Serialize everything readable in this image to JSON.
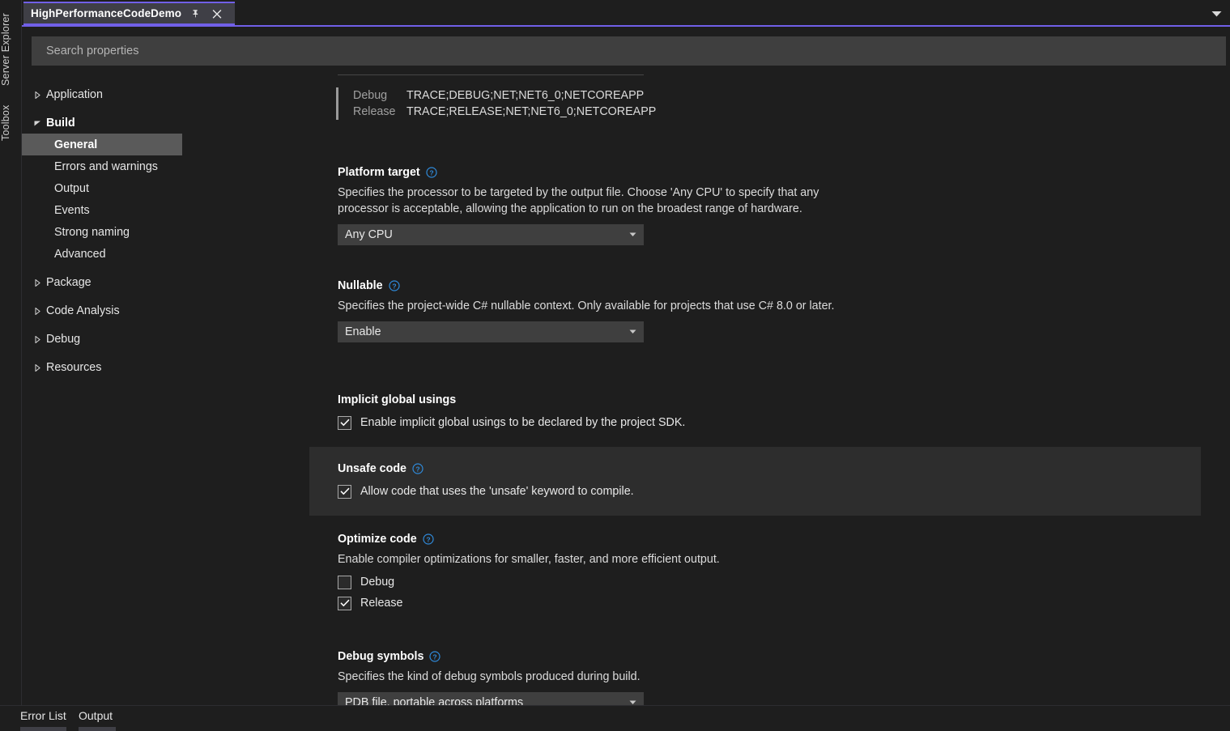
{
  "dock": {
    "server_explorer": "Server Explorer",
    "toolbox": "Toolbox"
  },
  "tab": {
    "title": "HighPerformanceCodeDemo",
    "pin_icon": "pin-icon",
    "close_icon": "close-icon",
    "overflow_icon": "chevron-down-icon",
    "accent_color": "#7160e8"
  },
  "search": {
    "value": "",
    "placeholder": "Search properties"
  },
  "nav": {
    "items": [
      {
        "label": "Application",
        "level": 1,
        "expanded": false,
        "selected": false
      },
      {
        "label": "Build",
        "level": 1,
        "expanded": true,
        "selected": false
      },
      {
        "label": "General",
        "level": 2,
        "selected": true
      },
      {
        "label": "Errors and warnings",
        "level": 2,
        "selected": false
      },
      {
        "label": "Output",
        "level": 2,
        "selected": false
      },
      {
        "label": "Events",
        "level": 2,
        "selected": false
      },
      {
        "label": "Strong naming",
        "level": 2,
        "selected": false
      },
      {
        "label": "Advanced",
        "level": 2,
        "selected": false
      },
      {
        "label": "Package",
        "level": 1,
        "expanded": false,
        "selected": false
      },
      {
        "label": "Code Analysis",
        "level": 1,
        "expanded": false,
        "selected": false
      },
      {
        "label": "Debug",
        "level": 1,
        "expanded": false,
        "selected": false
      },
      {
        "label": "Resources",
        "level": 1,
        "expanded": false,
        "selected": false
      }
    ]
  },
  "conditional_symbols": {
    "rows": [
      {
        "config": "Debug",
        "value": "TRACE;DEBUG;NET;NET6_0;NETCOREAPP"
      },
      {
        "config": "Release",
        "value": "TRACE;RELEASE;NET;NET6_0;NETCOREAPP"
      }
    ]
  },
  "sections": {
    "platform_target": {
      "title": "Platform target",
      "description": "Specifies the processor to be targeted by the output file. Choose 'Any CPU' to specify that any processor is acceptable, allowing the application to run on the broadest range of hardware.",
      "value": "Any CPU"
    },
    "nullable": {
      "title": "Nullable",
      "description": "Specifies the project-wide C# nullable context. Only available for projects that use C# 8.0 or later.",
      "value": "Enable"
    },
    "implicit_global_usings": {
      "title": "Implicit global usings",
      "checkbox_label": "Enable implicit global usings to be declared by the project SDK.",
      "checked": true
    },
    "unsafe_code": {
      "title": "Unsafe code",
      "checkbox_label": "Allow code that uses the 'unsafe' keyword to compile.",
      "checked": true,
      "highlighted": true
    },
    "optimize_code": {
      "title": "Optimize code",
      "description": "Enable compiler optimizations for smaller, faster, and more efficient output.",
      "debug_label": "Debug",
      "debug_checked": false,
      "release_label": "Release",
      "release_checked": true
    },
    "debug_symbols": {
      "title": "Debug symbols",
      "description": "Specifies the kind of debug symbols produced during build.",
      "value": "PDB file, portable across platforms"
    }
  },
  "status_tabs": {
    "error_list": "Error List",
    "output": "Output"
  }
}
